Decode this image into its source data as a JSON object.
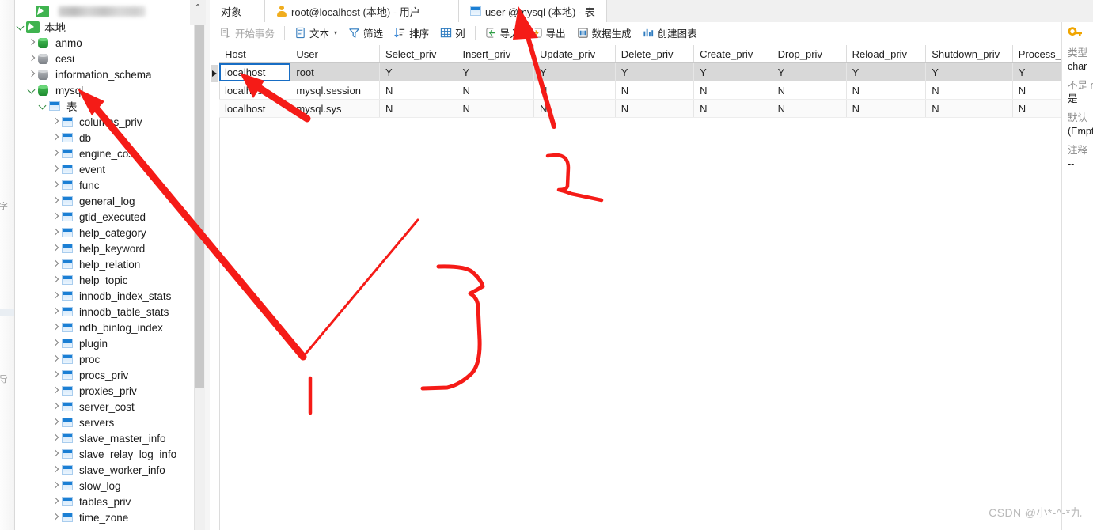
{
  "window": {
    "connection_title_redacted": "",
    "watermark": "CSDN @小*-^-*九"
  },
  "sidebar": {
    "scroll_up_arrow": "⌃",
    "edge_labels": [
      "字",
      "导"
    ],
    "root": {
      "label": "本地",
      "icon": "navicat-connection-icon",
      "expanded": true
    },
    "databases": [
      {
        "label": "anmo",
        "icon": "database-icon-green",
        "expanded": false
      },
      {
        "label": "cesi",
        "icon": "database-icon-grey",
        "expanded": false
      },
      {
        "label": "information_schema",
        "icon": "database-icon-grey",
        "expanded": false
      },
      {
        "label": "mysql",
        "icon": "database-icon-green",
        "expanded": true
      }
    ],
    "tables_group": {
      "label": "表",
      "icon": "table-folder-icon",
      "expanded": true
    },
    "tables": [
      "columns_priv",
      "db",
      "engine_cost",
      "event",
      "func",
      "general_log",
      "gtid_executed",
      "help_category",
      "help_keyword",
      "help_relation",
      "help_topic",
      "innodb_index_stats",
      "innodb_table_stats",
      "ndb_binlog_index",
      "plugin",
      "proc",
      "procs_priv",
      "proxies_priv",
      "server_cost",
      "servers",
      "slave_master_info",
      "slave_relay_log_info",
      "slave_worker_info",
      "slow_log",
      "tables_priv",
      "time_zone"
    ]
  },
  "tabs": {
    "scroll_up_arrow": "⌃",
    "items": [
      {
        "label": "对象",
        "icon": "objects-icon",
        "active": false
      },
      {
        "label": "root@localhost (本地) - 用户",
        "icon": "user-icon",
        "active": false
      },
      {
        "label": "user @mysql (本地) - 表",
        "icon": "table-icon",
        "active": true
      }
    ]
  },
  "toolbar": {
    "groups": [
      [
        {
          "label": "开始事务",
          "icon": "begin-transaction-icon",
          "disabled": true
        }
      ],
      [
        {
          "label": "文本",
          "icon": "text-icon",
          "caret": "▾",
          "disabled": false
        },
        {
          "label": "筛选",
          "icon": "filter-icon",
          "disabled": false
        },
        {
          "label": "排序",
          "icon": "sort-icon",
          "disabled": false
        },
        {
          "label": "列",
          "icon": "columns-icon",
          "disabled": false
        }
      ],
      [
        {
          "label": "导入",
          "icon": "import-icon",
          "disabled": false
        },
        {
          "label": "导出",
          "icon": "export-icon",
          "disabled": false
        },
        {
          "label": "数据生成",
          "icon": "data-generation-icon",
          "disabled": false
        },
        {
          "label": "创建图表",
          "icon": "create-chart-icon",
          "disabled": false
        }
      ]
    ]
  },
  "grid": {
    "columns": [
      "Host",
      "User",
      "Select_priv",
      "Insert_priv",
      "Update_priv",
      "Delete_priv",
      "Create_priv",
      "Drop_priv",
      "Reload_priv",
      "Shutdown_priv",
      "Process_priv"
    ],
    "rows": [
      {
        "selected": true,
        "selected_cell": 0,
        "cells": [
          "localhost",
          "root",
          "Y",
          "Y",
          "Y",
          "Y",
          "Y",
          "Y",
          "Y",
          "Y",
          "Y"
        ]
      },
      {
        "selected": false,
        "selected_cell": -1,
        "cells": [
          "localhost",
          "mysql.session",
          "N",
          "N",
          "N",
          "N",
          "N",
          "N",
          "N",
          "N",
          "N"
        ]
      },
      {
        "selected": false,
        "selected_cell": -1,
        "cells": [
          "localhost",
          "mysql.sys",
          "N",
          "N",
          "N",
          "N",
          "N",
          "N",
          "N",
          "N",
          "N"
        ]
      }
    ],
    "scroll_up_arrow": "⌃"
  },
  "info_pane": {
    "key_icon": "primary-key-icon",
    "fields": [
      {
        "label": "类型",
        "value": "char"
      },
      {
        "label": "不是 null",
        "value": "是"
      },
      {
        "label": "默认",
        "value": "(Empty"
      },
      {
        "label": "注释",
        "value": "--"
      }
    ]
  },
  "annotations": {
    "color": "#f51b17",
    "strokes": [
      {
        "name": "arrow-to-mysql-node",
        "type": "arrow"
      },
      {
        "name": "arrow-to-host-cell",
        "type": "arrow"
      },
      {
        "name": "arrow-to-user-tab",
        "type": "arrow"
      },
      {
        "name": "brace-small-upper",
        "type": "brace"
      },
      {
        "name": "brace-large-lower",
        "type": "brace"
      },
      {
        "name": "tick-mark-left",
        "type": "tick"
      }
    ]
  }
}
